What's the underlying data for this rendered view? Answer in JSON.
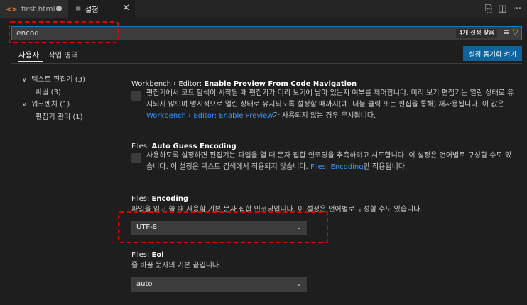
{
  "tabs": [
    {
      "label": "first.html",
      "icon": "html-icon",
      "glyph": "<>"
    },
    {
      "label": "설정",
      "icon": "settings-file-icon",
      "glyph": "≣"
    }
  ],
  "search": {
    "value": "encod",
    "results_badge": "4개 설정 찾음"
  },
  "scopes": {
    "user": "사용자",
    "workspace": "작업 영역"
  },
  "sync_button": "설정 동기화 켜기",
  "tree": [
    {
      "label": "텍스트 편집기 (3)",
      "expanded": true
    },
    {
      "label": "파일 (3)"
    },
    {
      "label": "워크벤치 (1)",
      "expanded": true
    },
    {
      "label": "편집기 관리 (1)"
    }
  ],
  "settings": {
    "preview": {
      "prefix": "Workbench › Editor: ",
      "title": "Enable Preview From Code Navigation",
      "desc_part1": "편집기에서 코드 탐색이 시작될 때 편집기가 미리 보기에 남아 있는지 여부를 제어합니다. 미리 보기 편집기는 열린 상태로 유지되지 않으며 명시적으로 열린 상태로 유지되도록 설정할 때까지(예: 더블 클릭 또는 편집을 통해) 재사용됩니다. 이 값은 ",
      "desc_link": "Workbench › Editor: Enable Preview",
      "desc_part2": "가 사용되지 않는 경우 무시됩니다."
    },
    "auto_guess": {
      "prefix": "Files: ",
      "title": "Auto Guess Encoding",
      "desc_part1": "사용하도록 설정하면 편집기는 파일을 열 때 문자 집합 인코딩을 추측하려고 시도합니다. 이 설정은 언어별로 구성할 수도 있습니다. 이 설정은 텍스트 검색에서 적용되지 않습니다. ",
      "desc_link": "Files: Encoding",
      "desc_part2": "만 적용됩니다."
    },
    "encoding": {
      "prefix": "Files: ",
      "title": "Encoding",
      "desc": "파일을 읽고 쓸 때 사용할 기본 문자 집합 인코딩입니다. 이 설정은 언어별로 구성할 수도 있습니다.",
      "value": "UTF-8"
    },
    "eol": {
      "prefix": "Files: ",
      "title": "Eol",
      "desc": "줄 바꿈 문자의 기본 끝입니다.",
      "value": "auto"
    }
  },
  "colors": {
    "accent": "#007fd4",
    "button": "#0e639c",
    "link": "#3794ff",
    "annotation": "#e00000"
  }
}
